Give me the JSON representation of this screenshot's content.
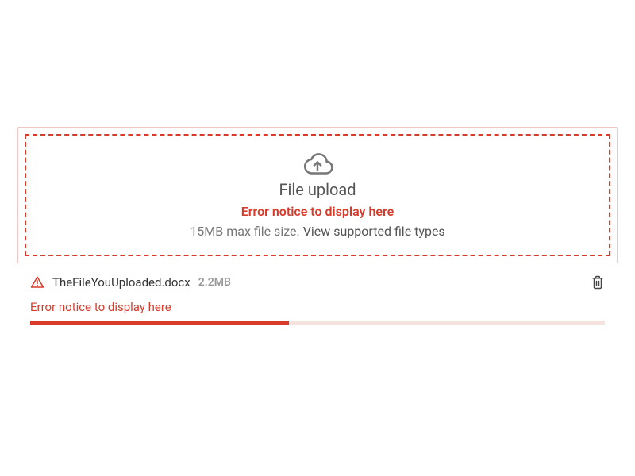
{
  "upload": {
    "title": "File upload",
    "error": "Error notice to display here",
    "hint_prefix": "15MB max file size. ",
    "hint_link": "View supported file types"
  },
  "file": {
    "name": "TheFileYouUploaded.docx",
    "size": "2.2MB",
    "error": "Error notice to display here",
    "progress_percent": 45
  },
  "colors": {
    "error": "#d93b2b"
  }
}
